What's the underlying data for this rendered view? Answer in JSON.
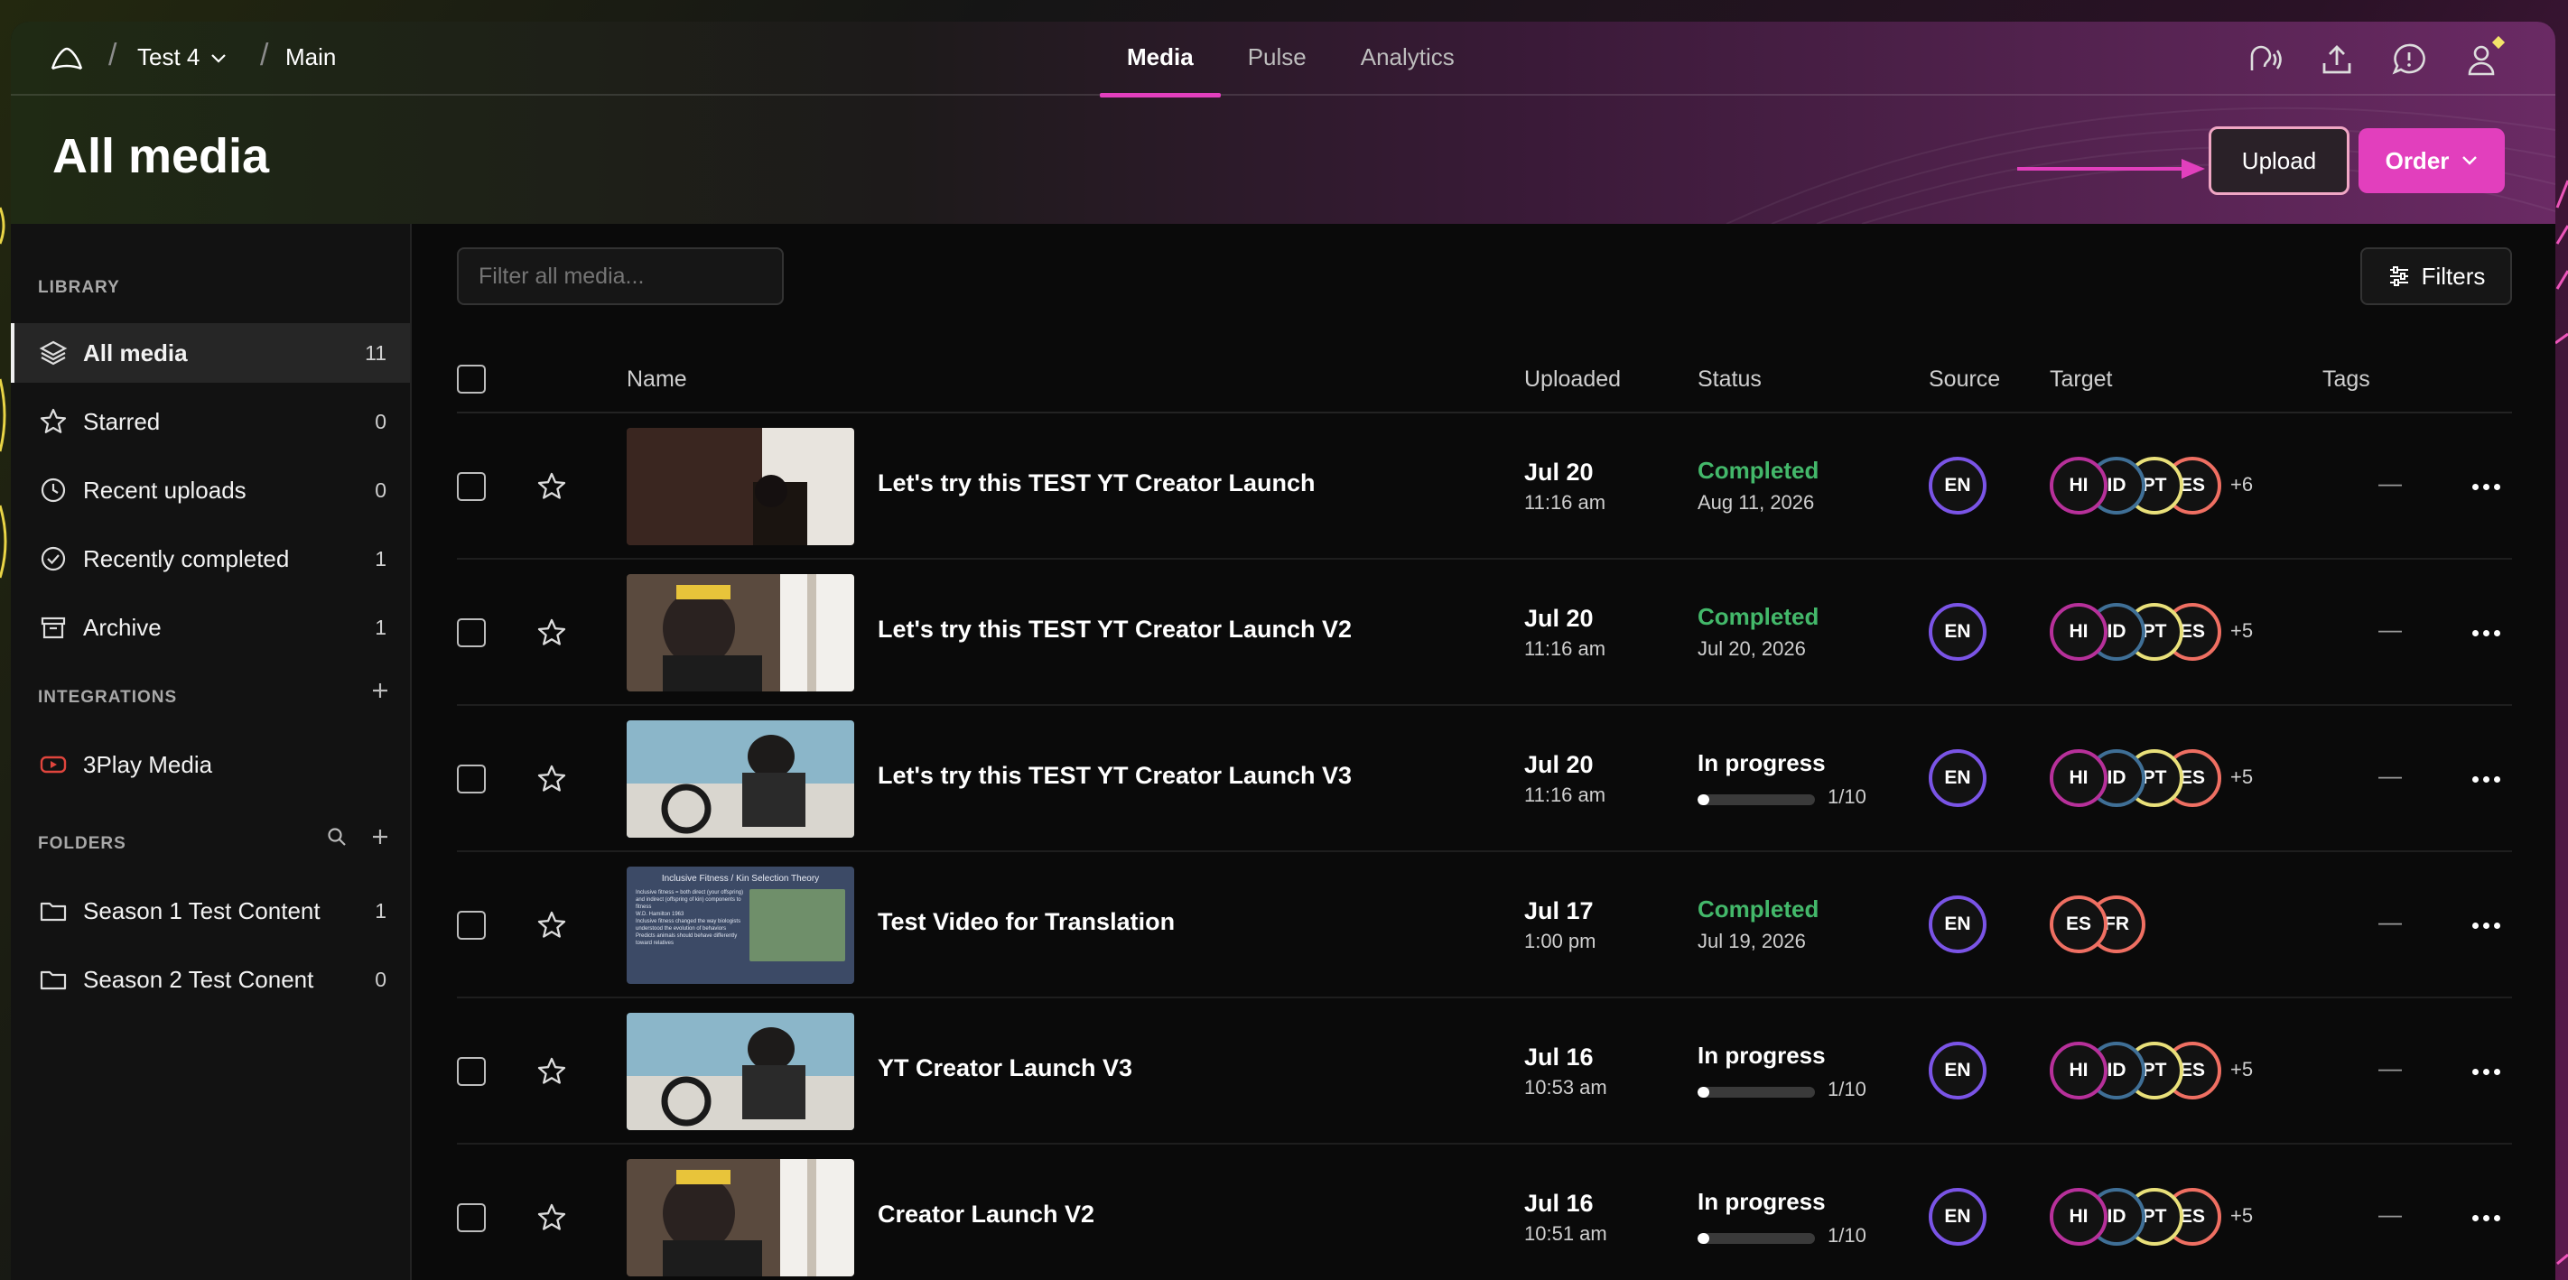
{
  "workspace": "Test 4",
  "breadcrumb_main": "Main",
  "nav_tabs": [
    {
      "label": "Media",
      "active": true
    },
    {
      "label": "Pulse",
      "active": false
    },
    {
      "label": "Analytics",
      "active": false
    }
  ],
  "page_title": "All media",
  "upload_label": "Upload",
  "order_label": "Order",
  "sidebar": {
    "library_label": "LIBRARY",
    "items": [
      {
        "label": "All media",
        "count": "11",
        "icon": "layers-icon"
      },
      {
        "label": "Starred",
        "count": "0",
        "icon": "star-icon"
      },
      {
        "label": "Recent uploads",
        "count": "0",
        "icon": "clock-icon"
      },
      {
        "label": "Recently completed",
        "count": "1",
        "icon": "check-circle-icon"
      },
      {
        "label": "Archive",
        "count": "1",
        "icon": "archive-icon"
      }
    ],
    "integrations_label": "INTEGRATIONS",
    "integration": "3Play Media",
    "folders_label": "FOLDERS",
    "folders": [
      {
        "label": "Season 1 Test Content",
        "count": "1"
      },
      {
        "label": "Season 2 Test Conent",
        "count": "0"
      }
    ]
  },
  "filter_placeholder": "Filter all media...",
  "filters_label": "Filters",
  "columns": {
    "name": "Name",
    "uploaded": "Uploaded",
    "status": "Status",
    "source": "Source",
    "target": "Target",
    "tags": "Tags"
  },
  "rows": [
    {
      "name": "Let's try this TEST YT Creator Launch",
      "date": "Jul 20",
      "time": "11:16 am",
      "status": "Completed",
      "status_sub": "Aug 11, 2026",
      "source": "EN",
      "targets": [
        "HI",
        "ID",
        "PT",
        "ES"
      ],
      "more": "+6",
      "tags": "—"
    },
    {
      "name": "Let's try this TEST YT Creator Launch V2",
      "date": "Jul 20",
      "time": "11:16 am",
      "status": "Completed",
      "status_sub": "Jul 20, 2026",
      "source": "EN",
      "targets": [
        "HI",
        "ID",
        "PT",
        "ES"
      ],
      "more": "+5",
      "tags": "—"
    },
    {
      "name": "Let's try this TEST YT Creator Launch V3",
      "date": "Jul 20",
      "time": "11:16 am",
      "status": "In progress",
      "progress": "1/10",
      "progress_fraction": 0.1,
      "source": "EN",
      "targets": [
        "HI",
        "ID",
        "PT",
        "ES"
      ],
      "more": "+5",
      "tags": "—"
    },
    {
      "name": "Test Video for Translation",
      "date": "Jul 17",
      "time": "1:00 pm",
      "status": "Completed",
      "status_sub": "Jul 19, 2026",
      "source": "EN",
      "targets": [
        "ES",
        "FR"
      ],
      "more": "",
      "tags": "—"
    },
    {
      "name": "YT Creator Launch V3",
      "date": "Jul 16",
      "time": "10:53 am",
      "status": "In progress",
      "progress": "1/10",
      "progress_fraction": 0.1,
      "source": "EN",
      "targets": [
        "HI",
        "ID",
        "PT",
        "ES"
      ],
      "more": "+5",
      "tags": "—"
    },
    {
      "name": "Creator Launch V2",
      "date": "Jul 16",
      "time": "10:51 am",
      "status": "In progress",
      "progress": "1/10",
      "progress_fraction": 0.1,
      "source": "EN",
      "targets": [
        "HI",
        "ID",
        "PT",
        "ES"
      ],
      "more": "+5",
      "tags": "—"
    }
  ],
  "slide_thumb": {
    "title": "Inclusive Fitness / Kin Selection Theory",
    "lines": [
      "Inclusive fitness = both direct (your offspring) and indirect (offspring of kin) components to fitness",
      "W.D. Hamilton 1963",
      "Inclusive fitness changed the way biologists understood the evolution of behaviors",
      "Predicts animals should behave differently toward relatives"
    ]
  },
  "lang_colors": {
    "EN": "#7a54e6",
    "HI": "#b7309a",
    "ID": "#3f6f96",
    "PT": "#e9e07a",
    "ES": "#ef6f62",
    "FR": "#ef6f62"
  },
  "accent": "#e23fbd",
  "completed_color": "#43b86a"
}
